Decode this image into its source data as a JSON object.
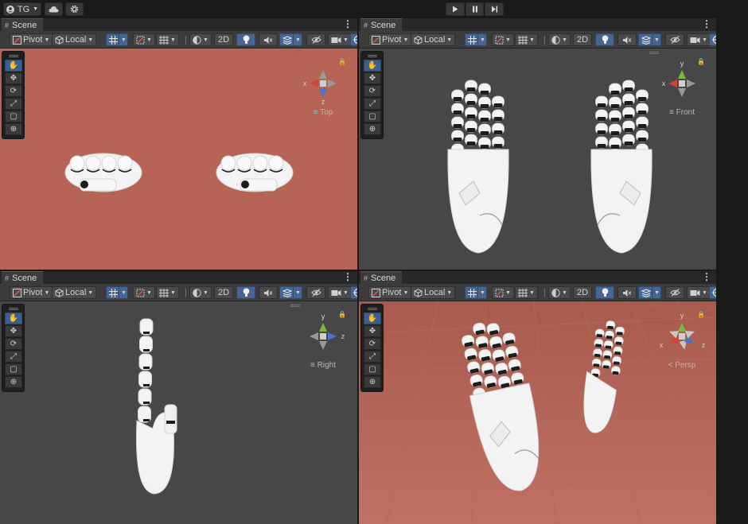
{
  "topbar": {
    "account_label": "TG",
    "account_icon": "account-icon",
    "cloud_icon": "cloud-icon",
    "settings_icon": "gear-icon",
    "play_icon": "play-icon",
    "pause_icon": "pause-icon",
    "step_icon": "step-icon"
  },
  "toolbar": {
    "pivot_label": "Pivot",
    "local_label": "Local",
    "mode_2d_label": "2D"
  },
  "tools": [
    "hand-tool",
    "move-tool",
    "rotate-tool",
    "scale-tool",
    "rect-tool",
    "transform-tool"
  ],
  "panes": [
    {
      "tab_label": "Scene",
      "gizmo_label": "Top",
      "axes": {
        "x": "x",
        "y": "",
        "z": "z"
      }
    },
    {
      "tab_label": "Scene",
      "gizmo_label": "Front",
      "axes": {
        "x": "x",
        "y": "y",
        "z": ""
      }
    },
    {
      "tab_label": "Scene",
      "gizmo_label": "Right",
      "axes": {
        "x": "",
        "y": "y",
        "z": "z"
      }
    },
    {
      "tab_label": "Scene",
      "gizmo_label": "Persp",
      "axes": {
        "x": "x",
        "y": "y",
        "z": "z"
      }
    }
  ],
  "colors": {
    "ground": "#b56455",
    "grid_bg": "#474747",
    "accent": "#466591",
    "axis_x": "#d0443a",
    "axis_y": "#7ab83a",
    "axis_z": "#4a70d0"
  }
}
